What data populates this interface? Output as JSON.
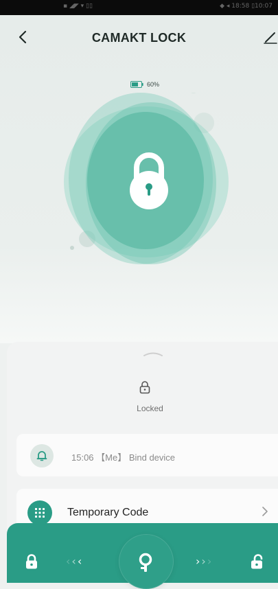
{
  "status_bar": {
    "left": "▪ ◢◤ ▾ ▯▯",
    "right": "◆ ◂ 18:58 ▯10:07"
  },
  "header": {
    "title": "CAMAKT LOCK"
  },
  "battery": {
    "level_text": "60%",
    "level": 0.6
  },
  "lock_state": {
    "label": "Locked"
  },
  "log": {
    "entry_text": "15:06 【Me】 Bind device"
  },
  "temporary_code": {
    "label": "Temporary Code"
  },
  "bottom_bar": {
    "left_arrows": [
      "‹",
      "‹",
      "‹"
    ],
    "right_arrows": [
      "›",
      "›",
      "›"
    ]
  },
  "colors": {
    "accent": "#2a9c86",
    "accent_light": "#7fd0bd",
    "background": "#eef1f0"
  },
  "icons": [
    "back-icon",
    "edit-icon",
    "battery-icon",
    "padlock-icon",
    "drag-handle-icon",
    "lock-status-icon",
    "bell-icon",
    "keypad-icon",
    "chevron-right-icon",
    "lock-icon",
    "key-icon",
    "unlock-icon"
  ]
}
